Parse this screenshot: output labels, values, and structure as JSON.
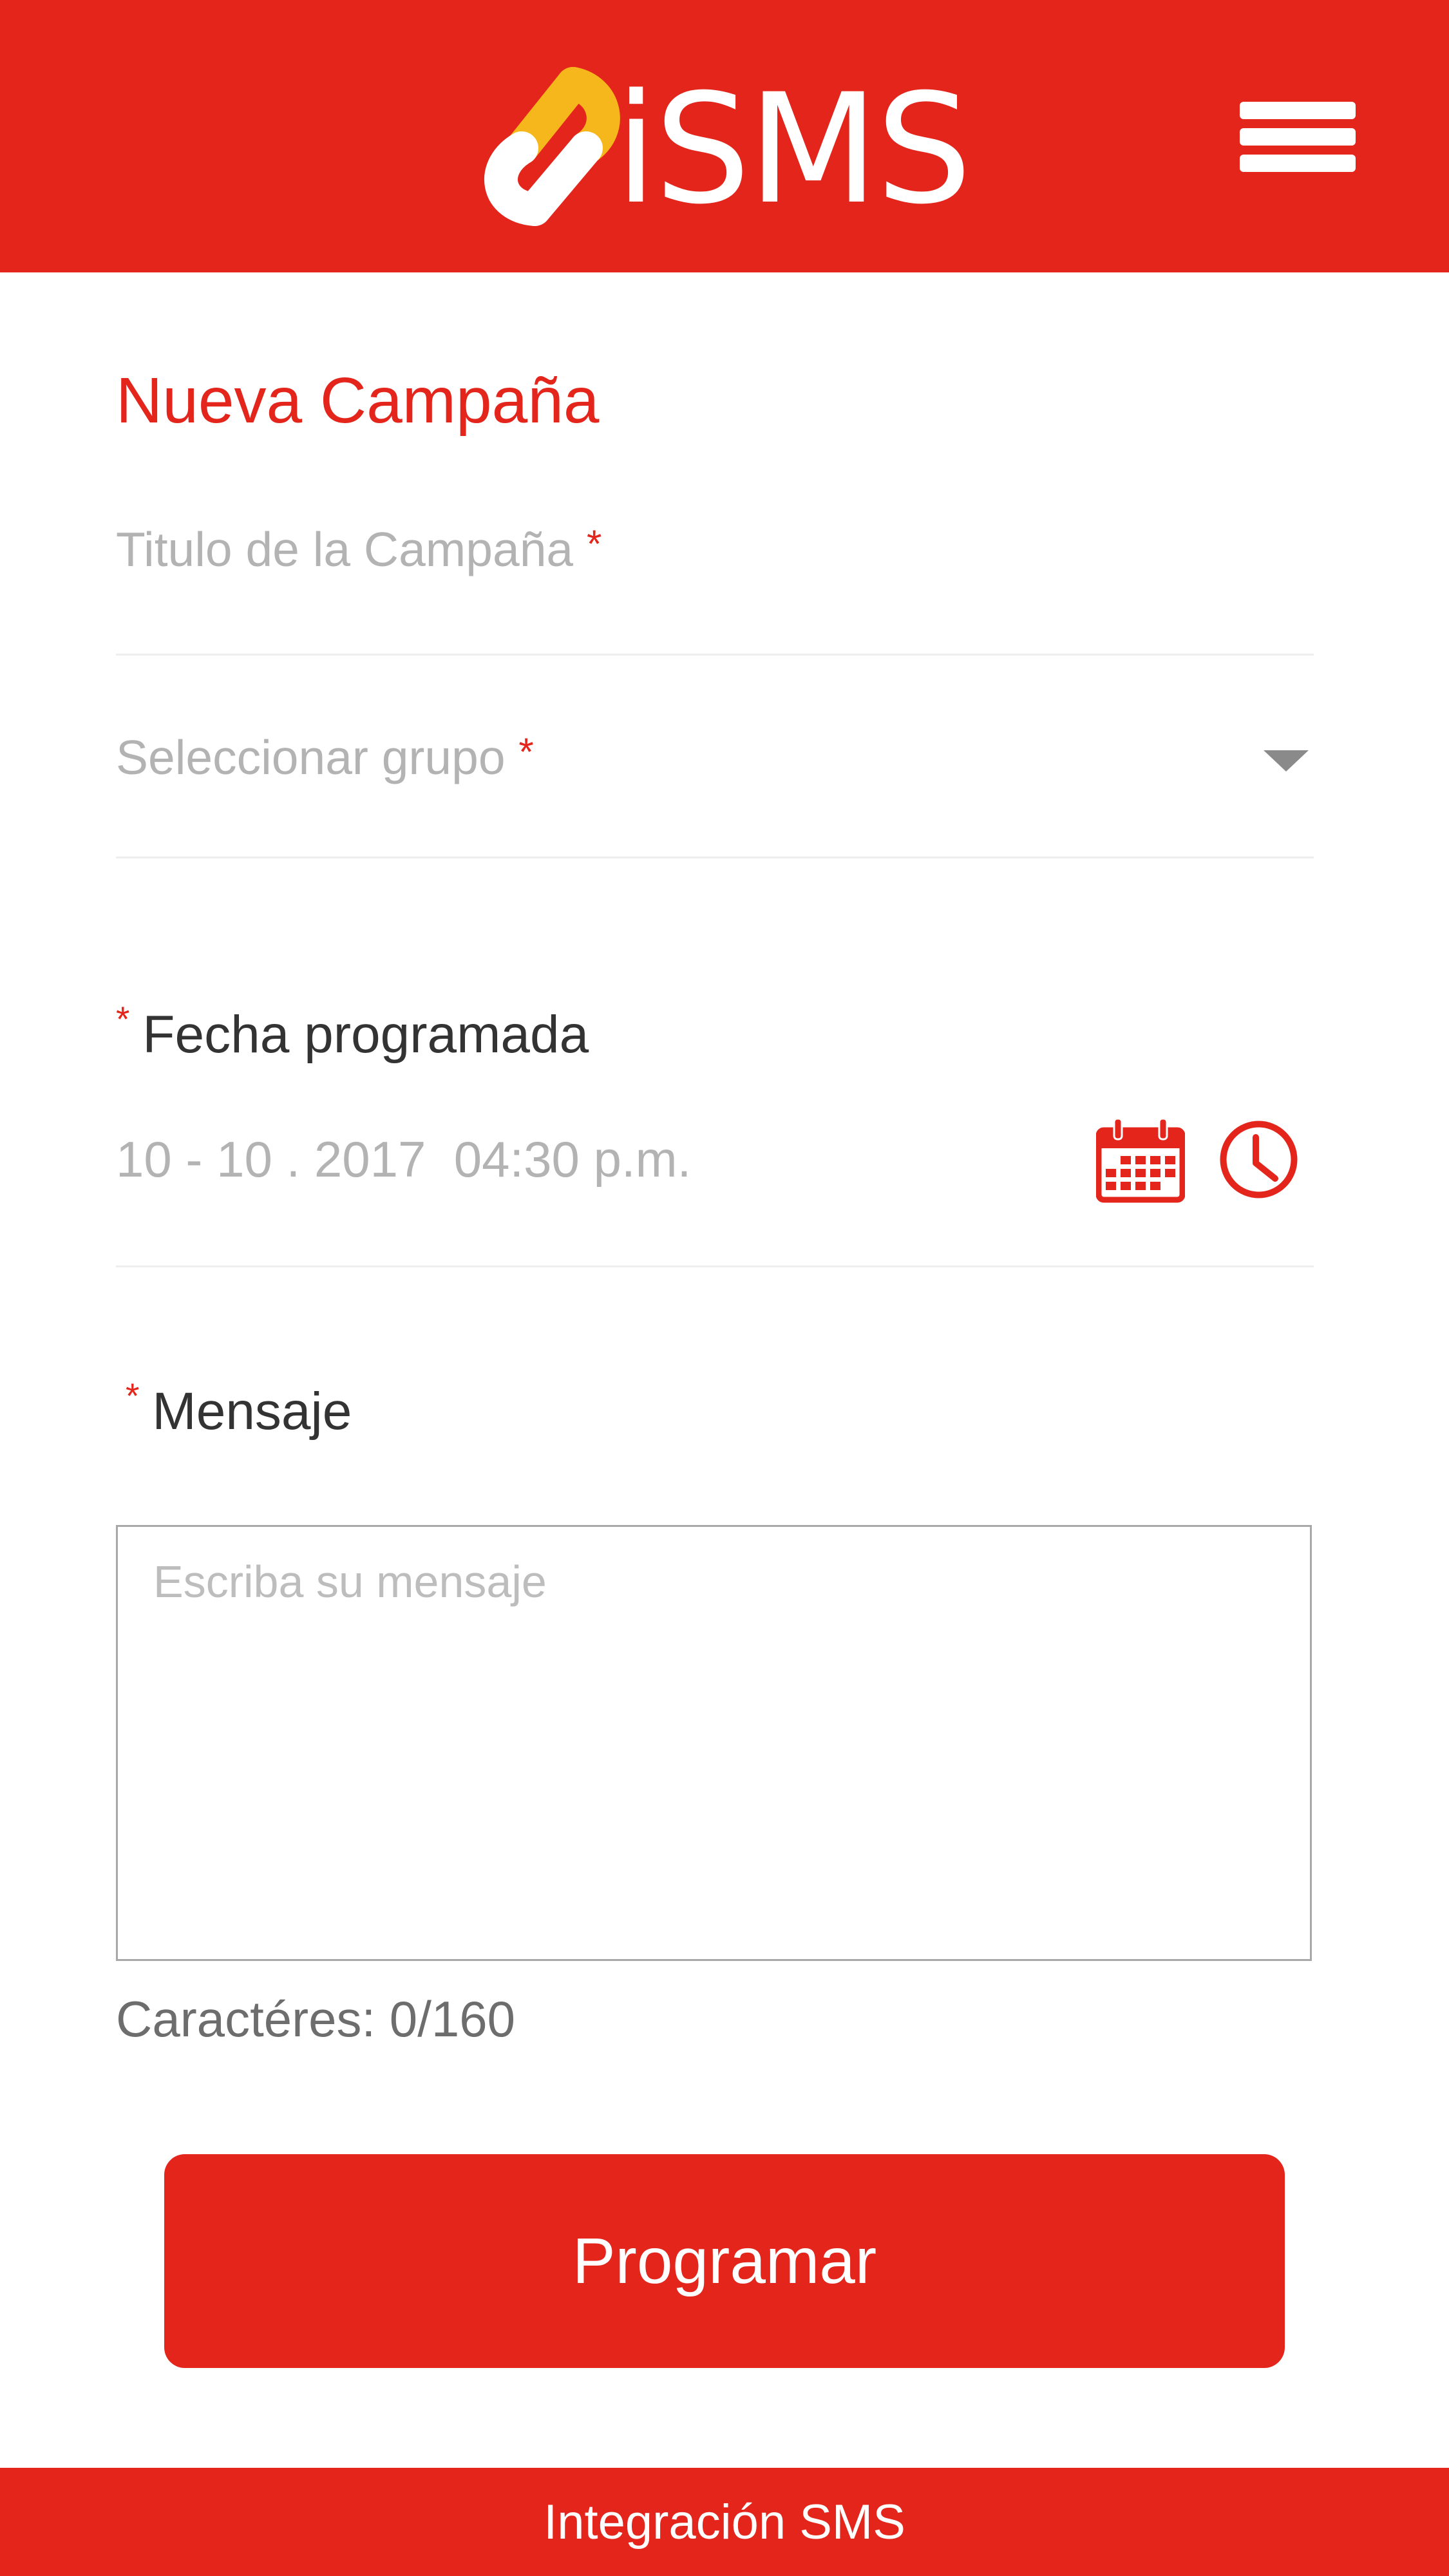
{
  "header": {
    "logo_text": "iSMS",
    "logo_alt": "iSMS logo",
    "menu_icon": "hamburger-menu-icon"
  },
  "colors": {
    "brand_red": "#e3251c",
    "logo_yellow": "#f5b71b",
    "placeholder_gray": "#b3b3b3"
  },
  "form": {
    "title": "Nueva Campaña",
    "campaign_title": {
      "placeholder": "Titulo de la Campaña",
      "required_mark": "*",
      "value": ""
    },
    "group_select": {
      "placeholder": "Seleccionar grupo",
      "required_mark": "*",
      "icon": "dropdown-arrow-icon"
    },
    "scheduled_date": {
      "label": "Fecha programada",
      "required_mark": "*",
      "value": "10 - 10 . 2017  04:30 p.m.",
      "calendar_icon": "calendar-icon",
      "clock_icon": "clock-icon"
    },
    "message": {
      "label": "Mensaje",
      "required_mark": "*",
      "placeholder": "Escriba su mensaje",
      "value": ""
    },
    "char_count": "Caractéres: 0/160",
    "submit_label": "Programar"
  },
  "footer": {
    "text": "Integración SMS"
  }
}
